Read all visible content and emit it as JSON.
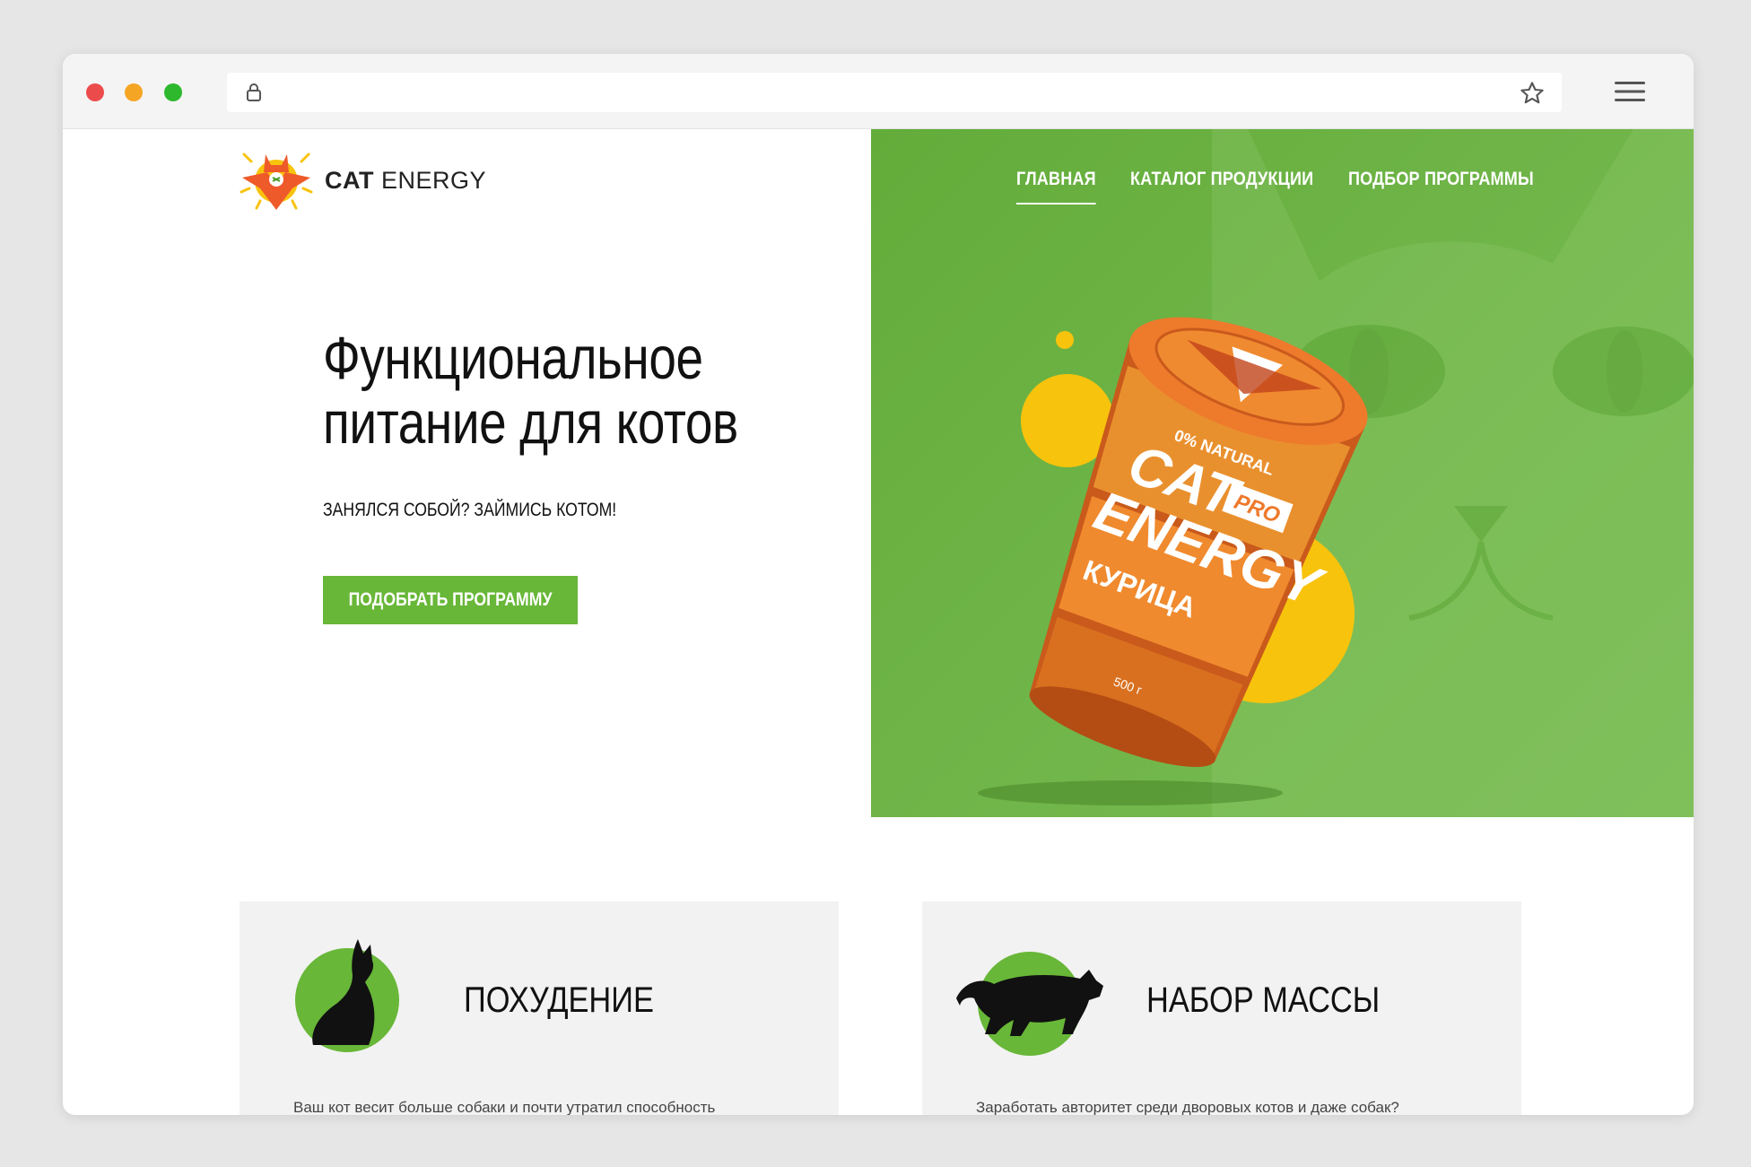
{
  "browser": {
    "lock_icon": "lock-icon",
    "bookmark_icon": "star-icon",
    "menu_icon": "hamburger-icon"
  },
  "site": {
    "logo": {
      "bold": "CAT",
      "regular": " ENERGY"
    },
    "nav": [
      {
        "label": "ГЛАВНАЯ",
        "active": true
      },
      {
        "label": "КАТАЛОГ ПРОДУКЦИИ",
        "active": false
      },
      {
        "label": "ПОДБОР ПРОГРАММЫ",
        "active": false
      }
    ],
    "hero": {
      "title_line1": "Функциональное",
      "title_line2": "питание для котов",
      "subtitle": "ЗАНЯЛСЯ СОБОЙ? ЗАЙМИСЬ КОТОМ!",
      "cta": "ПОДОБРАТЬ ПРОГРАММУ"
    },
    "product": {
      "badge": "0% NATURAL",
      "brand_line1": "CAT",
      "brand_pro": "PRO",
      "brand_line2": "ENERGY",
      "flavor": "КУРИЦА",
      "weight": "500 г"
    },
    "programs": [
      {
        "title": "ПОХУДЕНИЕ",
        "text": "Ваш кот весит больше собаки и почти утратил способность",
        "icon": "sitting-cat-icon"
      },
      {
        "title": "НАБОР МАССЫ",
        "text": "Заработать авторитет среди дворовых котов и даже собак?",
        "icon": "panther-icon"
      }
    ]
  },
  "colors": {
    "accent_green": "#68b738",
    "hero_green": "#6bb23f",
    "circle_yellow": "#f8c30d",
    "can_orange": "#ee7a2c"
  }
}
